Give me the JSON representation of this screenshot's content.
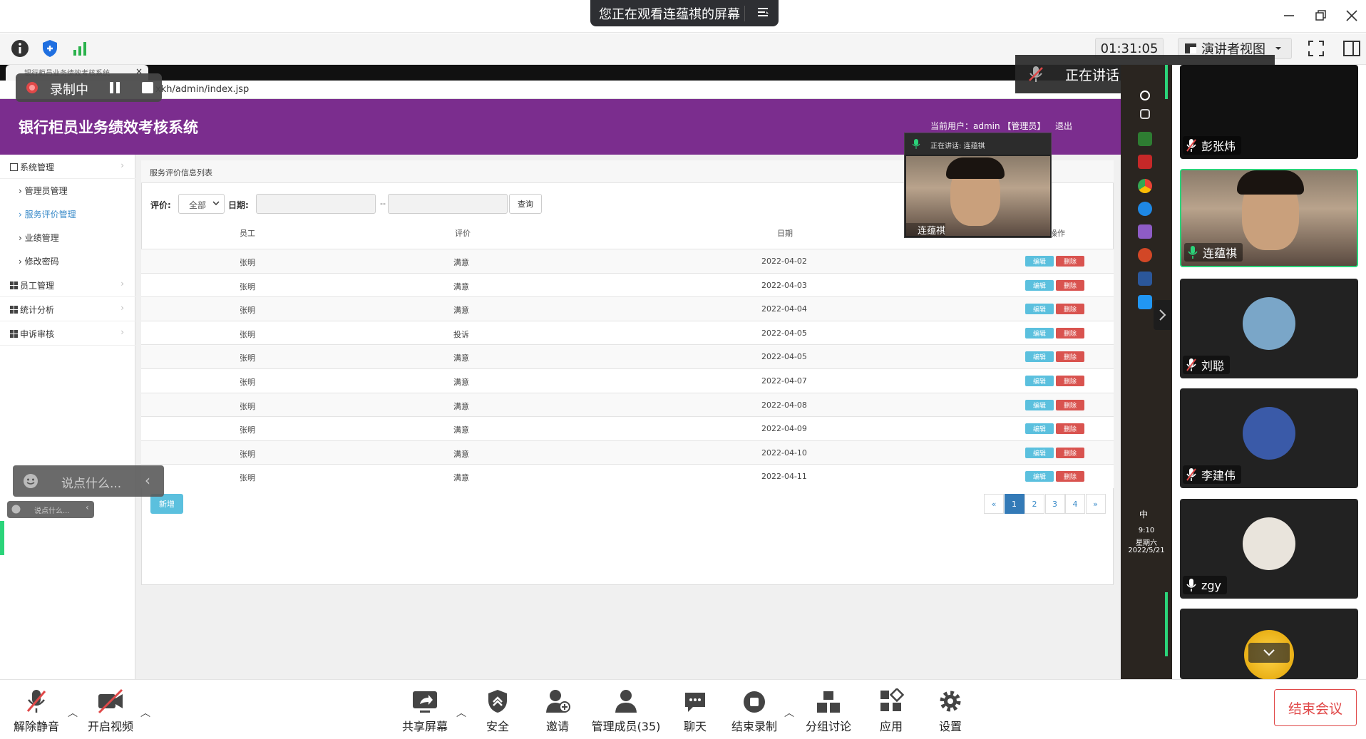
{
  "window": {
    "viewing_banner": "您正在观看连蕴祺的屏幕"
  },
  "toolbar": {
    "timer": "01:31:05",
    "view_mode": "演讲者视图"
  },
  "recording": {
    "label": "录制中"
  },
  "speaking_badge": {
    "label": "正在讲话: 连蕴祺"
  },
  "browser": {
    "tab_title": "银行柜员业务绩效考核系统",
    "url_partial": "xkh/admin/index.jsp"
  },
  "app": {
    "title": "银行柜员业务绩效考核系统",
    "user_info": "当前用户：admin 【管理员】",
    "logout": "退出",
    "sidebar": {
      "system_mgmt": "系统管理",
      "items": [
        "管理员管理",
        "服务评价管理",
        "业绩管理",
        "修改密码"
      ],
      "employee_mgmt": "员工管理",
      "stats": "统计分析",
      "appeal": "申诉审核"
    },
    "panel_title": "服务评价信息列表",
    "filter": {
      "rating_label": "评价:",
      "rating_value": "全部",
      "date_label": "日期:",
      "dash": "--",
      "search_button": "查询"
    },
    "table": {
      "headers": [
        "员工",
        "评价",
        "日期",
        "操作"
      ],
      "rows": [
        [
          "张明",
          "满意",
          "2022-04-02"
        ],
        [
          "张明",
          "满意",
          "2022-04-03"
        ],
        [
          "张明",
          "满意",
          "2022-04-04"
        ],
        [
          "张明",
          "投诉",
          "2022-04-05"
        ],
        [
          "张明",
          "满意",
          "2022-04-05"
        ],
        [
          "张明",
          "满意",
          "2022-04-07"
        ],
        [
          "张明",
          "满意",
          "2022-04-08"
        ],
        [
          "张明",
          "满意",
          "2022-04-09"
        ],
        [
          "张明",
          "满意",
          "2022-04-10"
        ],
        [
          "张明",
          "满意",
          "2022-04-11"
        ]
      ],
      "edit_label": "编辑",
      "delete_label": "删除"
    },
    "add_button": "新增",
    "pagination": [
      "«",
      "1",
      "2",
      "3",
      "4",
      "»"
    ],
    "chat_placeholder": "说点什么..."
  },
  "pip": {
    "speaking": "正在讲话: 连蕴祺",
    "name": "连蕴祺"
  },
  "taskbar": {
    "ime": "中",
    "time": "9:10",
    "weekday": "星期六",
    "date": "2022/5/21"
  },
  "participants": [
    {
      "name": "彭张炜",
      "muted": true
    },
    {
      "name": "连蕴祺",
      "muted": false
    },
    {
      "name": "刘聪",
      "muted": true
    },
    {
      "name": "李建伟",
      "muted": true
    },
    {
      "name": "zgy",
      "muted": false
    }
  ],
  "bottom_bar": {
    "unmute": "解除静音",
    "video": "开启视频",
    "share": "共享屏幕",
    "security": "安全",
    "invite": "邀请",
    "members": "管理成员(35)",
    "chat": "聊天",
    "end_recording": "结束录制",
    "breakout": "分组讨论",
    "apps": "应用",
    "settings": "设置",
    "end_meeting": "结束会议"
  },
  "colors": {
    "app_header": "#7b2d8e",
    "edit_button": "#5bc0de",
    "delete_button": "#d9534f",
    "end_meeting": "#e04848",
    "active_speaker": "#2bd47a"
  }
}
